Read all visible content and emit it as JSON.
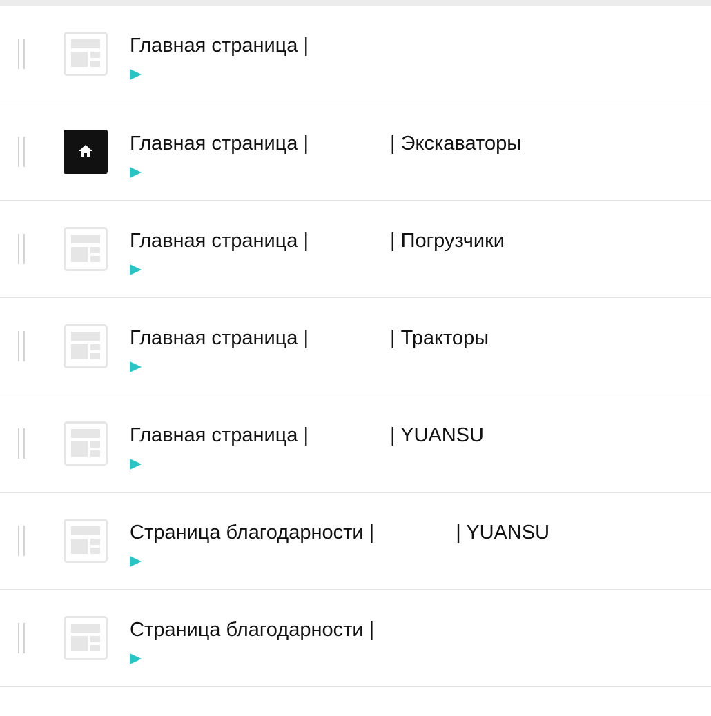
{
  "pages": [
    {
      "id": "row-1",
      "icon": "template-thumbnail",
      "title": "Главная страница |",
      "suffix": ""
    },
    {
      "id": "row-2",
      "icon": "home-icon",
      "title": "Главная страница |",
      "suffix": "| Экскаваторы"
    },
    {
      "id": "row-3",
      "icon": "template-thumbnail",
      "title": "Главная страница |",
      "suffix": "| Погрузчики"
    },
    {
      "id": "row-4",
      "icon": "template-thumbnail",
      "title": "Главная страница |",
      "suffix": "| Тракторы"
    },
    {
      "id": "row-5",
      "icon": "template-thumbnail",
      "title": "Главная страница |",
      "suffix": "| YUANSU"
    },
    {
      "id": "row-6",
      "icon": "template-thumbnail",
      "title": "Страница благодарности |",
      "suffix": "| YUANSU"
    },
    {
      "id": "row-7",
      "icon": "template-thumbnail",
      "title": "Страница благодарности |",
      "suffix": ""
    }
  ],
  "colors": {
    "accent": "#29c4c4",
    "text": "#111111",
    "divider": "#e3e3e3",
    "thumbnail": "#e6e6e6",
    "home_badge": "#111111"
  }
}
